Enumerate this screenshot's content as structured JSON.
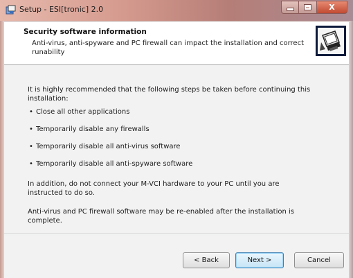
{
  "window": {
    "title": "Setup - ESI[tronic] 2.0",
    "icon": "setup-installer-icon",
    "controls": {
      "minimize": "minimize",
      "maximize": "maximize",
      "close": "X"
    }
  },
  "header": {
    "title": "Security software information",
    "description": "Anti-virus, anti-spyware and PC firewall can impact the installation and correct runability",
    "logo": "computer-install-icon"
  },
  "content": {
    "intro": "It is highly recommended that the following steps be taken before continuing this installation:",
    "bullets": [
      "Close all other applications",
      "Temporarily disable any firewalls",
      "Temporarily disable all anti-virus software",
      "Temporarily disable all anti-spyware software"
    ],
    "note1": "In addition, do not connect your M-VCI hardware to your PC until you are instructed to do so.",
    "note2": "Anti-virus and PC firewall software may be re-enabled after the installation is complete."
  },
  "footer": {
    "back_label": "< Back",
    "next_label": "Next >",
    "cancel_label": "Cancel"
  },
  "colors": {
    "titlebar": "#d59a8e",
    "close_button": "#c14a32",
    "panel_background": "#f3f2f2",
    "default_button_border": "#3c7fb1"
  }
}
